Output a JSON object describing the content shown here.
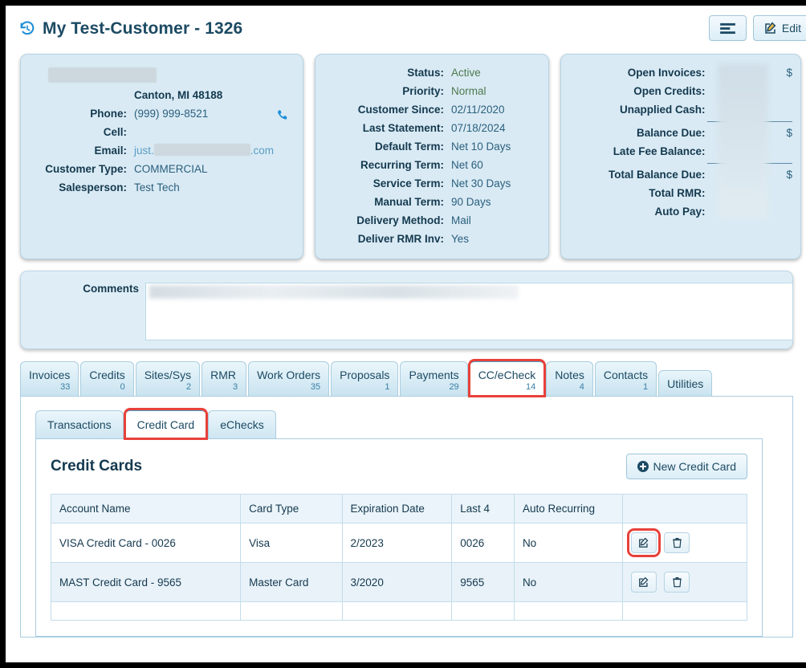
{
  "header": {
    "history_icon": "history-restore-icon",
    "title": "My Test-Customer - 1326",
    "list_button_icon": "list-lines-icon",
    "edit_button_label": "Edit",
    "edit_button_icon": "pencil-square-icon"
  },
  "contact_card": {
    "name_redacted": "",
    "city_state_zip": "Canton, MI 48188",
    "rows": [
      {
        "label": "Phone:",
        "value": "(999) 999-8521"
      },
      {
        "label": "Cell:",
        "value": ""
      },
      {
        "label": "Customer Type:",
        "value": "COMMERCIAL"
      },
      {
        "label": "Salesperson:",
        "value": "Test Tech"
      }
    ],
    "email_label": "Email:",
    "email_prefix": "just.",
    "email_suffix": ".com",
    "phone_icon": "phone-icon"
  },
  "status_card": {
    "rows": [
      {
        "label": "Status:",
        "value": "Active",
        "green": true
      },
      {
        "label": "Priority:",
        "value": "Normal",
        "green": true
      },
      {
        "label": "Customer Since:",
        "value": "02/11/2020"
      },
      {
        "label": "Last Statement:",
        "value": "07/18/2024"
      },
      {
        "label": "Default Term:",
        "value": "Net 10 Days"
      },
      {
        "label": "Recurring Term:",
        "value": "Net 60"
      },
      {
        "label": "Service Term:",
        "value": "Net 30 Days"
      },
      {
        "label": "Manual Term:",
        "value": "90 Days"
      },
      {
        "label": "Delivery Method:",
        "value": "Mail"
      },
      {
        "label": "Deliver RMR Inv:",
        "value": "Yes"
      }
    ]
  },
  "balance_card": {
    "rows": [
      {
        "label": "Open Invoices:",
        "value": "$"
      },
      {
        "label": "Open Credits:",
        "value": ""
      },
      {
        "label": "Unapplied Cash:",
        "value": ""
      },
      {
        "label": "Balance Due:",
        "value": "$"
      },
      {
        "label": "Late Fee Balance:",
        "value": ""
      },
      {
        "label": "Total Balance Due:",
        "value": "$"
      },
      {
        "label": "Total RMR:",
        "value": ""
      },
      {
        "label": "Auto Pay:",
        "value": ""
      }
    ]
  },
  "comments": {
    "label": "Comments",
    "value": ""
  },
  "tabs": [
    {
      "label": "Invoices",
      "count": "33",
      "active": false,
      "highlight": false
    },
    {
      "label": "Credits",
      "count": "0",
      "active": false,
      "highlight": false
    },
    {
      "label": "Sites/Sys",
      "count": "2",
      "active": false,
      "highlight": false
    },
    {
      "label": "RMR",
      "count": "3",
      "active": false,
      "highlight": false
    },
    {
      "label": "Work Orders",
      "count": "35",
      "active": false,
      "highlight": false
    },
    {
      "label": "Proposals",
      "count": "1",
      "active": false,
      "highlight": false
    },
    {
      "label": "Payments",
      "count": "29",
      "active": false,
      "highlight": false
    },
    {
      "label": "CC/eCheck",
      "count": "14",
      "active": true,
      "highlight": true
    },
    {
      "label": "Notes",
      "count": "4",
      "active": false,
      "highlight": false
    },
    {
      "label": "Contacts",
      "count": "1",
      "active": false,
      "highlight": false
    },
    {
      "label": "Utilities",
      "count": "",
      "active": false,
      "highlight": false
    }
  ],
  "inner_tabs": [
    {
      "label": "Transactions",
      "active": false,
      "highlight": false
    },
    {
      "label": "Credit Card",
      "active": true,
      "highlight": true
    },
    {
      "label": "eChecks",
      "active": false,
      "highlight": false
    }
  ],
  "credit_cards_section": {
    "title": "Credit Cards",
    "new_button_label": "New Credit Card",
    "new_button_icon": "plus-circle-icon",
    "columns": [
      "Account Name",
      "Card Type",
      "Expiration Date",
      "Last 4",
      "Auto Recurring",
      ""
    ],
    "rows": [
      {
        "account_name": "VISA Credit Card - 0026",
        "card_type": "Visa",
        "expiration_date": "2/2023",
        "last4": "0026",
        "auto_recurring": "No",
        "edit_icon": "edit-pencil-icon",
        "delete_icon": "trash-icon",
        "edit_highlight": true
      },
      {
        "account_name": "MAST Credit Card - 9565",
        "card_type": "Master Card",
        "expiration_date": "3/2020",
        "last4": "9565",
        "auto_recurring": "No",
        "edit_icon": "edit-pencil-icon",
        "delete_icon": "trash-icon",
        "edit_highlight": false
      }
    ]
  },
  "colors": {
    "accent_blue": "#1c4a63",
    "card_bg": "#d9eaf4",
    "highlight_red": "#e8413a",
    "status_green": "#4e7a4e"
  }
}
